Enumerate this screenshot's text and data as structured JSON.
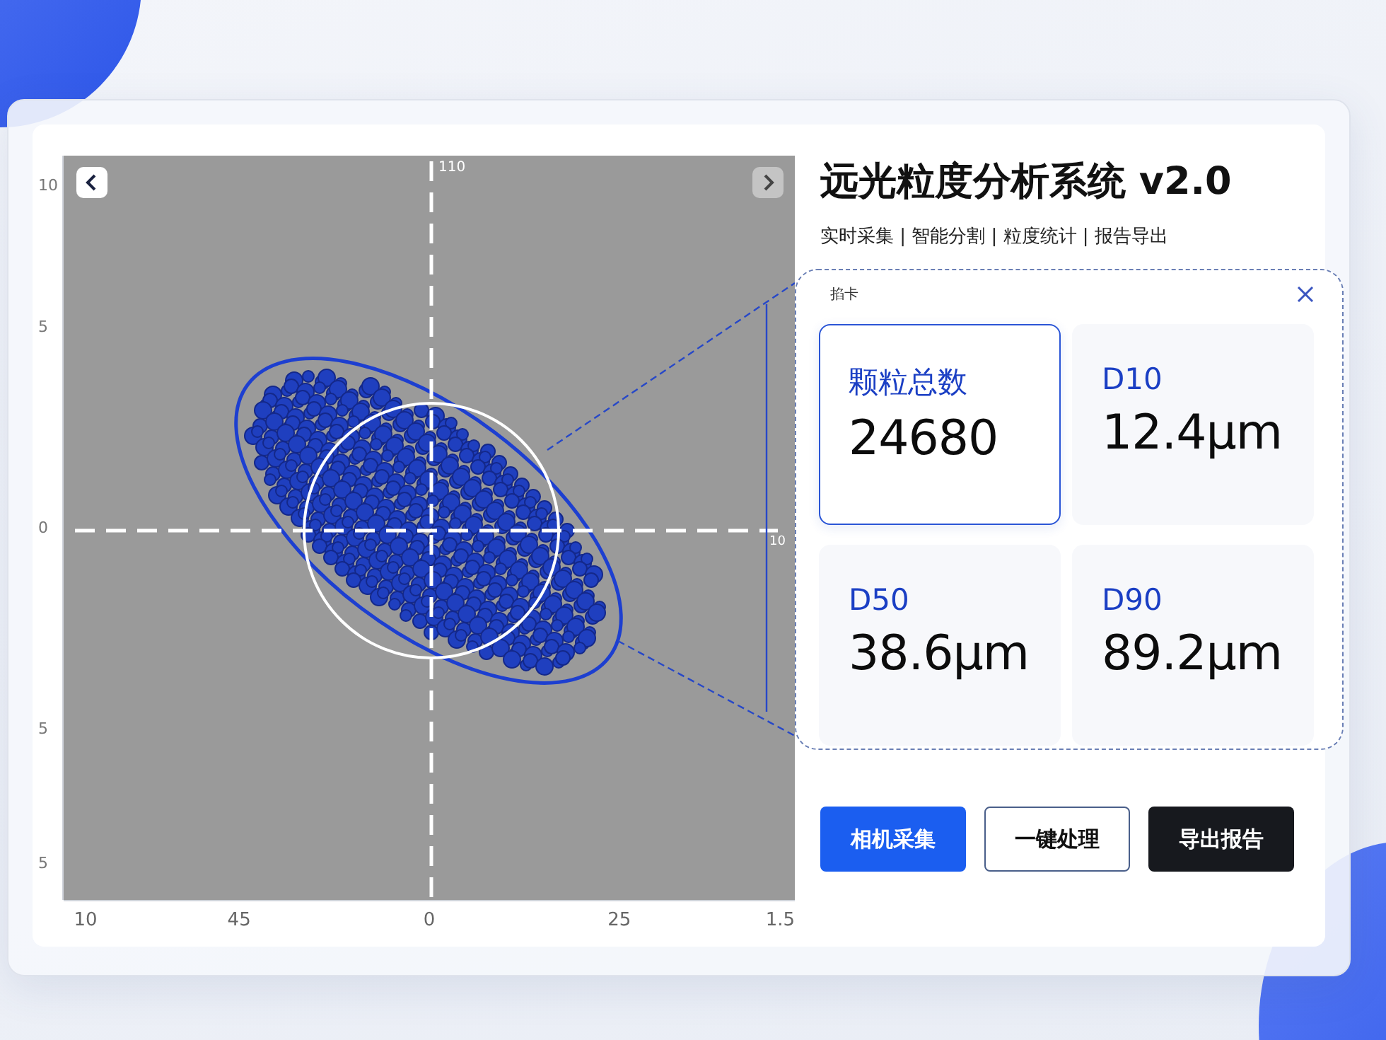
{
  "image_panel": {
    "top_label": "110",
    "right_label": "10",
    "y_labels": [
      "10",
      "5",
      "0",
      "5",
      "5"
    ],
    "x_labels": [
      "10",
      "45",
      "0",
      "25",
      "1.5"
    ]
  },
  "title": "远光粒度分析系统 v2.0",
  "subtitle": "实时采集 | 智能分割 | 粒度统计 | 报告导出",
  "stats_panel": {
    "label": "掐卡",
    "stats": [
      {
        "label": "颗粒总数",
        "value": "24680",
        "selected": true
      },
      {
        "label": "D10",
        "value": "12.4μm",
        "selected": false
      },
      {
        "label": "D50",
        "value": "38.6μm",
        "selected": false
      },
      {
        "label": "D90",
        "value": "89.2μm",
        "selected": false
      }
    ]
  },
  "buttons": [
    {
      "label": "相机采集",
      "kind": "primary"
    },
    {
      "label": "一键处理",
      "kind": "outline"
    },
    {
      "label": "导出报告",
      "kind": "dark"
    }
  ]
}
